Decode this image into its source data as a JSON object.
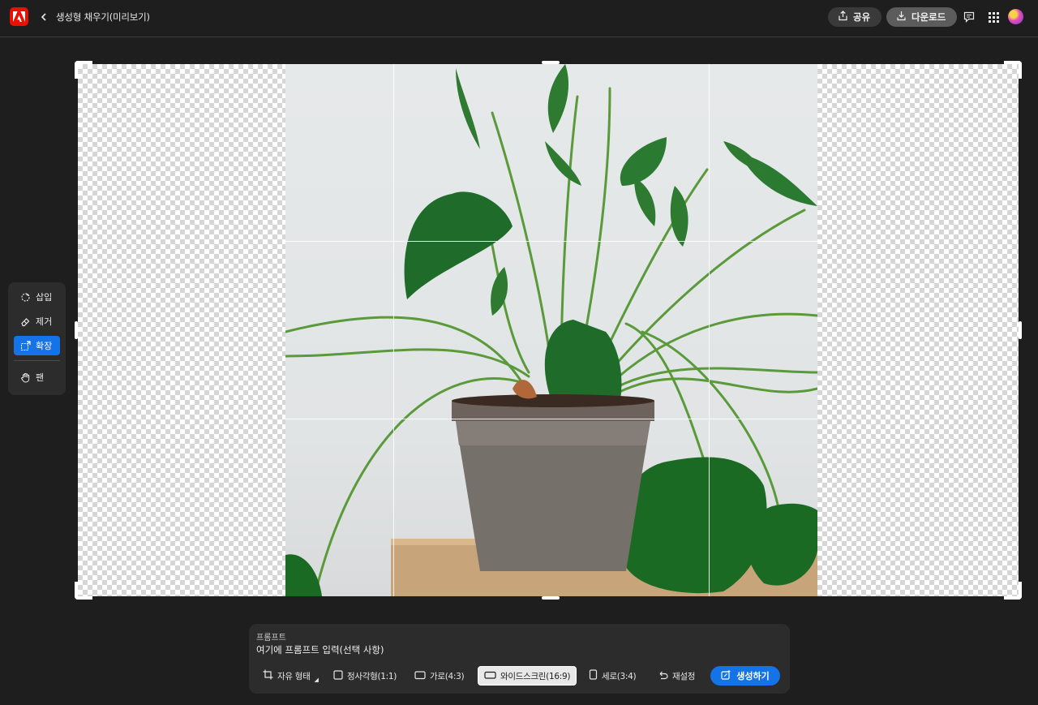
{
  "header": {
    "title": "생성형 채우기(미리보기)",
    "share_label": "공유",
    "download_label": "다운로드",
    "icons": [
      "adobe-logo",
      "back-icon",
      "share-icon",
      "download-icon",
      "comment-icon",
      "apps-grid-icon",
      "avatar"
    ]
  },
  "toolbar": {
    "items": [
      {
        "label": "삽입",
        "icon": "insert-icon",
        "active": false
      },
      {
        "label": "제거",
        "icon": "remove-icon",
        "active": false
      },
      {
        "label": "확장",
        "icon": "expand-icon",
        "active": true
      },
      {
        "label": "팬",
        "icon": "hand-icon",
        "active": false
      }
    ]
  },
  "prompt": {
    "label": "프롬프트",
    "placeholder": "여기에 프롬프트 입력(선택 사항)",
    "aspect_options": [
      {
        "label": "자유 형태",
        "icon": "crop-icon",
        "selected": false
      },
      {
        "label": "정사각형(1:1)",
        "icon": "square-icon",
        "selected": false
      },
      {
        "label": "가로(4:3)",
        "icon": "landscape-icon",
        "selected": false
      },
      {
        "label": "와이드스크린(16:9)",
        "icon": "widescreen-icon",
        "selected": true
      },
      {
        "label": "세로(3:4)",
        "icon": "portrait-icon",
        "selected": false
      }
    ],
    "reset_label": "재설정",
    "generate_label": "생성하기"
  },
  "colors": {
    "accent": "#1473e6",
    "adobe_red": "#eb1000",
    "background": "#1e1e1e",
    "panel": "#2c2c2c"
  }
}
